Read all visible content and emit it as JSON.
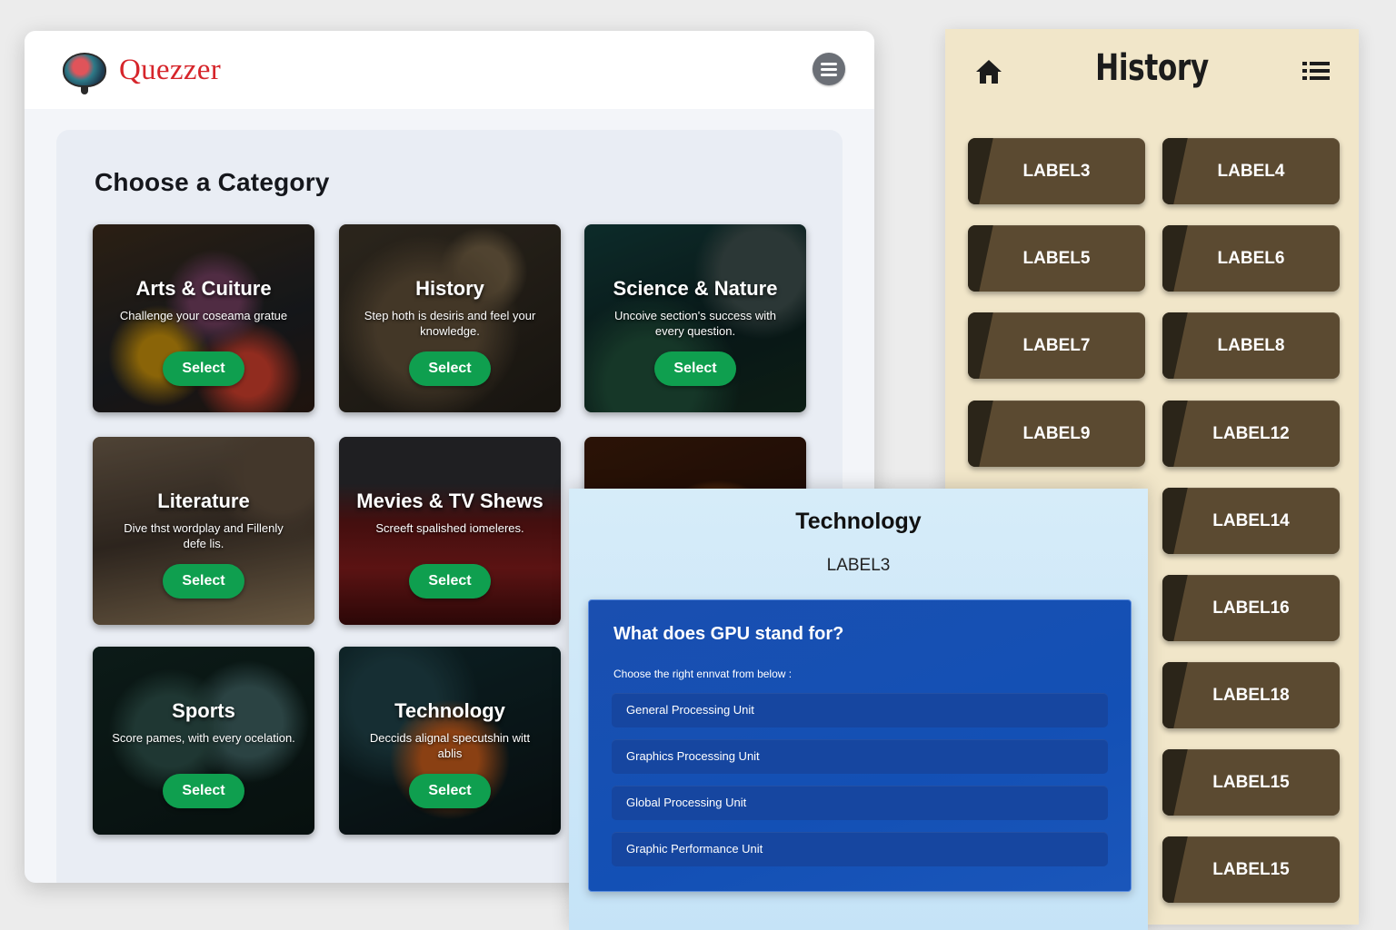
{
  "app": {
    "brand": "Quezzer",
    "panel_title": "Choose a Category",
    "categories": [
      {
        "title": "Arts & Cuiture",
        "desc": "Challenge your coseama gratue",
        "button": "Select"
      },
      {
        "title": "History",
        "desc": "Step hoth is desiris and feel your knowledge.",
        "button": "Select"
      },
      {
        "title": "Science & Nature",
        "desc": "Uncoive section's success with every question.",
        "button": "Select"
      },
      {
        "title": "Literature",
        "desc": "Dive thst wordplay and Fillenly defe lis.",
        "button": "Select"
      },
      {
        "title": "Mevies & TV Shews",
        "desc": "Screeft spalished iomeleres.",
        "button": "Select"
      },
      {
        "title": "",
        "desc": "",
        "button": ""
      },
      {
        "title": "Sports",
        "desc": "Score pames, with every ocelation.",
        "button": "Select"
      },
      {
        "title": "Technology",
        "desc": "Deccids alignal specutshin witt ablis",
        "button": "Select"
      }
    ]
  },
  "history": {
    "title": "History",
    "labels": [
      "LABEL3",
      "LABEL4",
      "LABEL5",
      "LABEL6",
      "LABEL7",
      "LABEL8",
      "LABEL9",
      "LABEL12",
      "LABEL14",
      "LABEL16",
      "LABEL18",
      "LABEL15",
      "LABEL15"
    ]
  },
  "quiz": {
    "title": "Technology",
    "subtitle": "LABEL3",
    "question": "What does GPU stand for?",
    "instruction": "Choose the right ennvat from below :",
    "options": [
      "General Processing Unit",
      "Graphics Processing Unit",
      "Global Processing Unit",
      "Graphic Performance Unit"
    ]
  }
}
